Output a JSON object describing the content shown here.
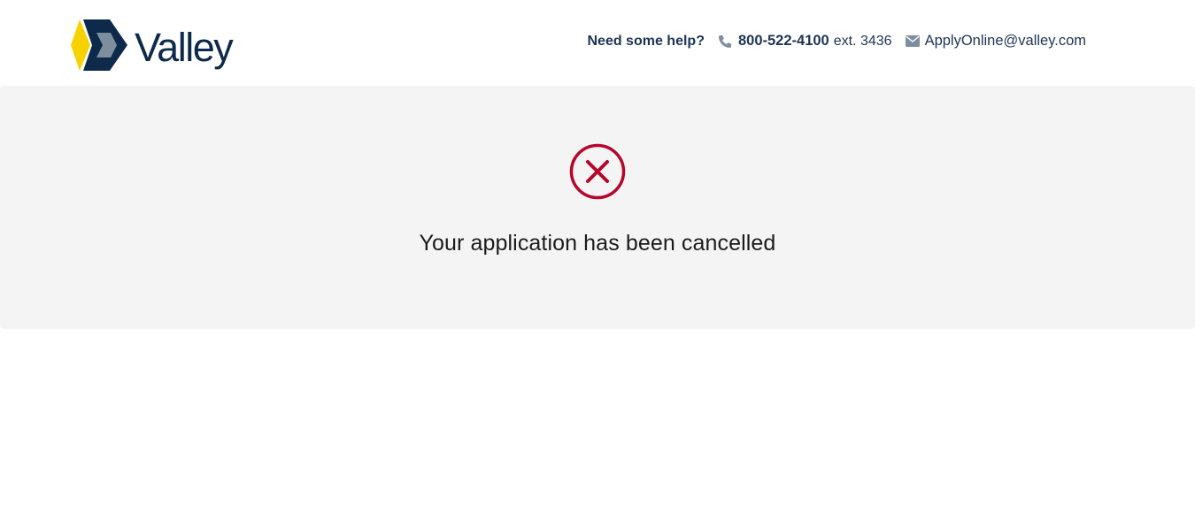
{
  "brand": {
    "name": "Valley",
    "colors": {
      "navy": "#0d2a4b",
      "gold": "#f6d300",
      "slate": "#7d8e9e",
      "error_red": "#b5072c"
    }
  },
  "header": {
    "help_label": "Need some help?",
    "phone": {
      "icon": "phone-icon",
      "number": "800-522-4100",
      "extension": "ext. 3436"
    },
    "email": {
      "icon": "envelope-icon",
      "address": "ApplyOnline@valley.com"
    }
  },
  "status": {
    "icon": "cancel-circle-icon",
    "message": "Your application has been cancelled"
  }
}
